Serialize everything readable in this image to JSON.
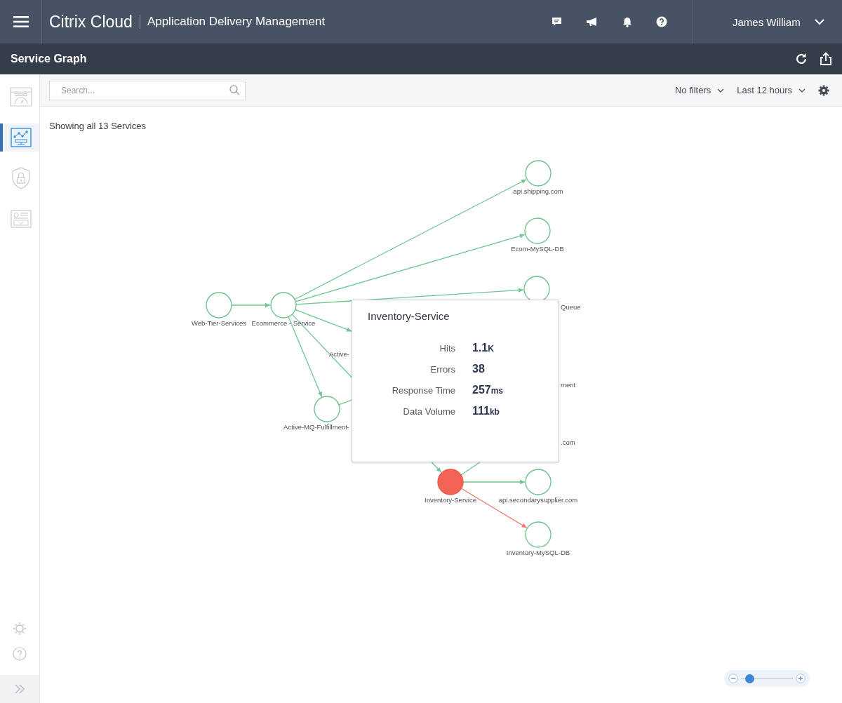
{
  "header": {
    "brand": "Citrix Cloud",
    "product": "Application Delivery Management",
    "user": "James William"
  },
  "page_title": "Service Graph",
  "sidebar": {
    "items": [
      {
        "selected": false
      },
      {
        "selected": true
      },
      {
        "selected": false
      },
      {
        "selected": false
      }
    ]
  },
  "toolbar": {
    "search": {
      "placeholder": "Search..."
    },
    "filter": "No filters",
    "time_range": "Last 12 hours"
  },
  "summary": "Showing all 13 Services",
  "graph": {
    "nodes": [
      {
        "kind": "node",
        "label": "Web-Tier-Services",
        "alert": false
      },
      {
        "kind": "node",
        "label": "Ecommerce - Service",
        "alert": false
      },
      {
        "kind": "node",
        "label": "api.shipping.com",
        "alert": false
      },
      {
        "kind": "node",
        "label": "Ecom-MySQL-DB",
        "alert": false
      },
      {
        "kind": "node",
        "label": "Queue",
        "alert": false
      },
      {
        "kind": "label",
        "label": "Active-"
      },
      {
        "kind": "label",
        "label": "ment"
      },
      {
        "kind": "node",
        "label": "Active-MQ-Fulfillment-",
        "alert": false
      },
      {
        "kind": "label",
        "label": ".com"
      },
      {
        "kind": "node",
        "label": "Inventory-Service",
        "alert": true
      },
      {
        "kind": "node",
        "label": "api.secondarysupplier.com",
        "alert": false
      },
      {
        "kind": "node",
        "label": "Inventory-MySQL-DB",
        "alert": false
      }
    ],
    "edges": [
      {
        "alert": false
      },
      {
        "alert": false
      },
      {
        "alert": false
      },
      {
        "alert": false
      },
      {
        "alert": false
      },
      {
        "alert": false
      },
      {
        "alert": false
      },
      {
        "alert": false
      },
      {
        "alert": false
      },
      {
        "alert": false
      },
      {
        "alert": true
      }
    ]
  },
  "tooltip": {
    "title": "Inventory-Service",
    "metrics": [
      {
        "label": "Hits",
        "value": "1.1",
        "unit": "K"
      },
      {
        "label": "Errors",
        "value": "38"
      },
      {
        "label": "Response Time",
        "value": "257",
        "unit": "ms"
      },
      {
        "label": "Data Volume",
        "value": "111",
        "unit": "kb"
      }
    ]
  },
  "zoom": {
    "level": 0.08
  }
}
